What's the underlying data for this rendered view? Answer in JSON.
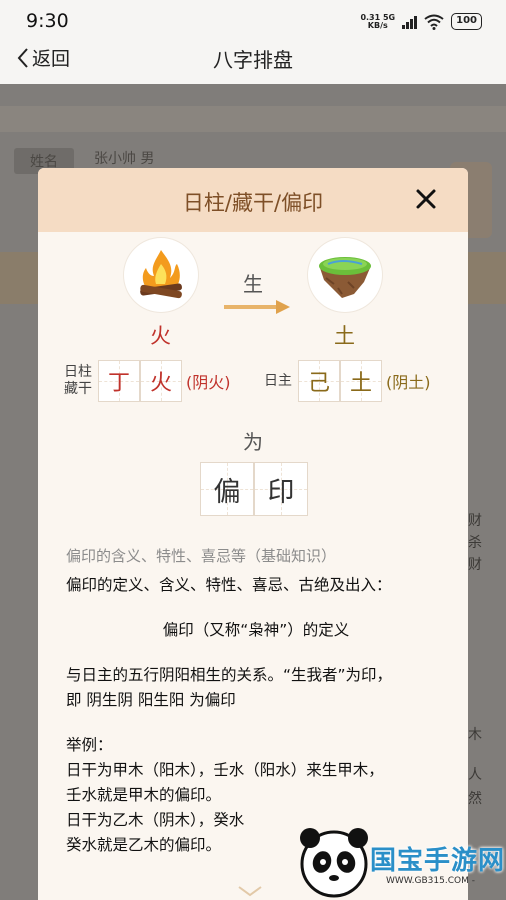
{
  "status_bar": {
    "time": "9:30",
    "net_speed": "0.31",
    "net_unit": "KB/s",
    "net_type": "5G",
    "battery": "100"
  },
  "nav": {
    "back_label": "返回",
    "title": "八字排盘"
  },
  "background_page": {
    "name_label": "姓名",
    "name_value": "张小帅 男",
    "side_texts": [
      "财",
      "杀",
      "财",
      "木",
      "人",
      "然"
    ]
  },
  "modal": {
    "title": "日柱/藏干/偏印",
    "left_element": {
      "name": "火",
      "color": "#c0322b"
    },
    "relation": "生",
    "right_element": {
      "name": "土",
      "color": "#8a6a1a"
    },
    "left_group": {
      "label_line1": "日柱",
      "label_line2": "藏干",
      "chars": [
        "丁",
        "火"
      ],
      "note": "(阴火)",
      "color": "#c0322b"
    },
    "right_group": {
      "label": "日主",
      "chars": [
        "己",
        "土"
      ],
      "note": "(阴土)",
      "color": "#8a6a1a"
    },
    "result_word": "为",
    "result_chars": [
      "偏",
      "印"
    ],
    "section_subtitle": "偏印的含义、特性、喜忌等（基础知识）",
    "content": {
      "heading": "偏印的定义、含义、特性、喜忌、古绝及出入：",
      "center_title": "偏印（又称“枭神”）的定义",
      "para1_line1": "与日主的五行阴阳相生的关系。“生我者”为印，",
      "para1_line2": "即 阴生阴 阳生阳 为偏印",
      "example_label": "举例：",
      "ex_line1": "日干为甲木（阳木），壬水（阳水）来生甲木，",
      "ex_line2": "壬水就是甲木的偏印。",
      "ex_line3": "日干为乙木（阴木），癸水",
      "ex_line4": "癸水就是乙木的偏印。"
    }
  },
  "watermark": {
    "brand": "国宝手游网",
    "url": "WWW.GB315.COM -"
  }
}
